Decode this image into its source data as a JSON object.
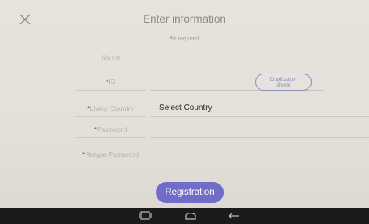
{
  "dialog": {
    "title": "Enter information",
    "required_star": "*",
    "required_note": "is required"
  },
  "form": {
    "name": {
      "label": "Name",
      "required": false,
      "value": ""
    },
    "id": {
      "label": "ID",
      "required": true,
      "value": ""
    },
    "country": {
      "label": "Living Country",
      "required": true,
      "selected": "Select Country"
    },
    "password": {
      "label": "Password",
      "required": true,
      "value": ""
    },
    "retype_password": {
      "label": "Retype Password",
      "required": true,
      "value": ""
    },
    "duplication_check": {
      "line1": "Duplication",
      "line2": "check"
    },
    "star": "*"
  },
  "buttons": {
    "registration": "Registration"
  },
  "icons": {
    "close": "close-icon",
    "recent_apps": "recent-apps-icon",
    "home": "home-icon",
    "back": "back-icon"
  },
  "colors": {
    "accent": "#6f6dc8",
    "required_star": "#d23b3b",
    "background": "#e3dfd9",
    "navbar": "#1b1b1b"
  }
}
